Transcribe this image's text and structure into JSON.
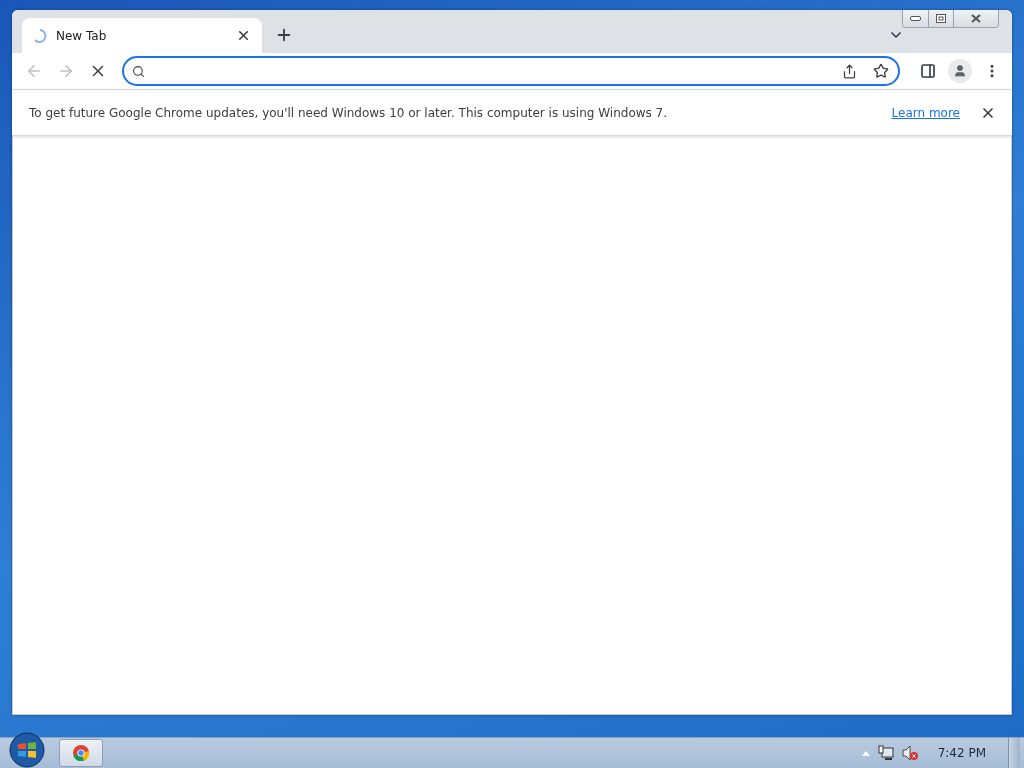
{
  "window": {
    "tabs": [
      {
        "title": "New Tab",
        "selected": true,
        "loading": true
      }
    ],
    "toolbar": {
      "back_disabled": true,
      "forward_disabled": true,
      "loading": true,
      "omnibox_focused": true
    },
    "infobar": {
      "message": "To get future Google Chrome updates, you'll need Windows 10 or later. This computer is using Windows 7.",
      "link": "Learn more"
    }
  },
  "taskbar": {
    "clock": "7:42 PM",
    "volume_muted": true
  }
}
